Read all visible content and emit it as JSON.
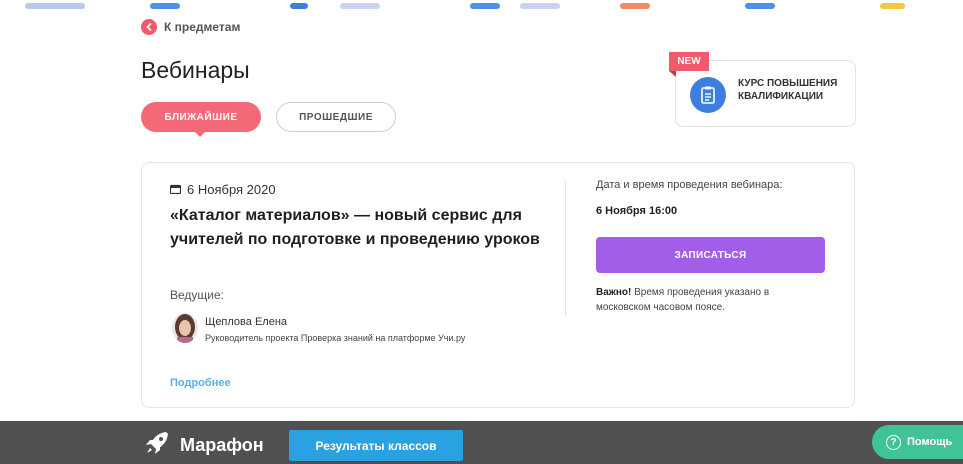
{
  "nav": {
    "back_label": "К предметам"
  },
  "page": {
    "title": "Вебинары"
  },
  "tabs": [
    {
      "label": "БЛИЖАЙШИЕ",
      "active": true
    },
    {
      "label": "ПРОШЕДШИЕ",
      "active": false
    }
  ],
  "course_promo": {
    "badge": "NEW",
    "label": "КУРС ПОВЫШЕНИЯ КВАЛИФИКАЦИИ",
    "icon": "document-icon"
  },
  "webinar": {
    "date": "6 Ноября 2020",
    "title": "«Каталог материалов» — новый сервис для учителей по подготовке и проведению уроков",
    "hosts_label": "Ведущие:",
    "host": {
      "name": "Щеплова Елена",
      "role": "Руководитель проекта Проверка знаний на платформе Учи.ру"
    },
    "more_label": "Подробнее",
    "datetime_label": "Дата и время проведения вебинара:",
    "datetime_value": "6 Ноября 16:00",
    "signup_label": "ЗАПИСАТЬСЯ",
    "note_bold": "Важно!",
    "note_text": " Время проведения указано в московском часовом поясе."
  },
  "bottom_bar": {
    "title": "Марафон",
    "results_label": "Результаты классов",
    "help_label": "Помощь"
  },
  "colors": {
    "accent_pink": "#f46878",
    "accent_purple": "#a25ee8",
    "accent_blue": "#2aa1e0",
    "help_green": "#3ec497",
    "bar_dark": "#505050"
  }
}
